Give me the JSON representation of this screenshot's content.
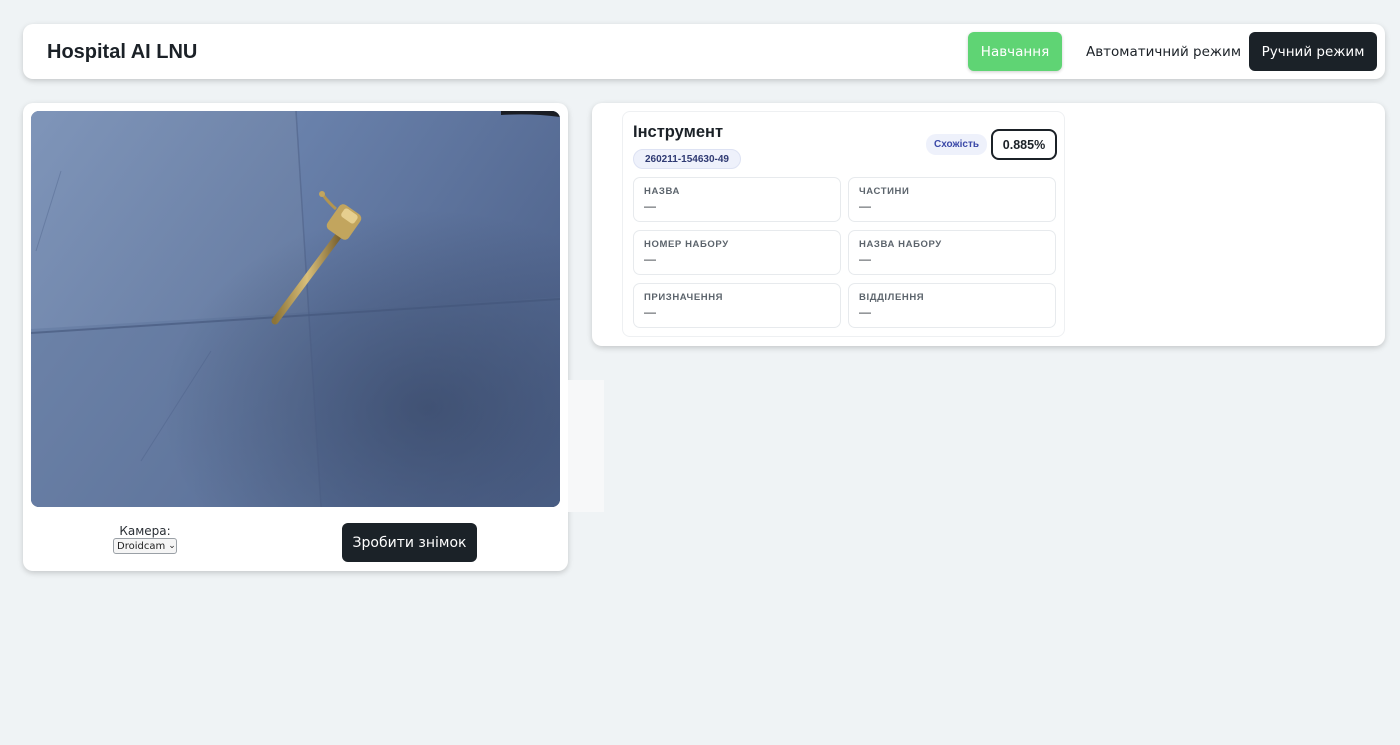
{
  "header": {
    "brand": "Hospital AI LNU",
    "nav": {
      "train": "Навчання",
      "auto": "Автоматичний режим",
      "manual": "Ручний режим"
    }
  },
  "camera": {
    "label": "Камера:",
    "selected_device": "Droidcam",
    "snapshot_button": "Зробити знімок"
  },
  "result": {
    "title": "Інструмент",
    "id_badge": "260211-154630-49",
    "similarity_label": "Схожість",
    "similarity_value": "0.885%",
    "fields": [
      {
        "label": "НАЗВА",
        "value": "—"
      },
      {
        "label": "ЧАСТИНИ",
        "value": "—"
      },
      {
        "label": "НОМЕР НАБОРУ",
        "value": "—"
      },
      {
        "label": "НАЗВА НАБОРУ",
        "value": "—"
      },
      {
        "label": "ПРИЗНАЧЕННЯ",
        "value": "—"
      },
      {
        "label": "ВІДДІЛЕННЯ",
        "value": "—"
      }
    ]
  },
  "colors": {
    "accent_green": "#5fd474",
    "dark": "#1b2228",
    "badge_bg": "#eef1fb"
  },
  "icons": {
    "select_chevron": "chevron-down-icon"
  }
}
